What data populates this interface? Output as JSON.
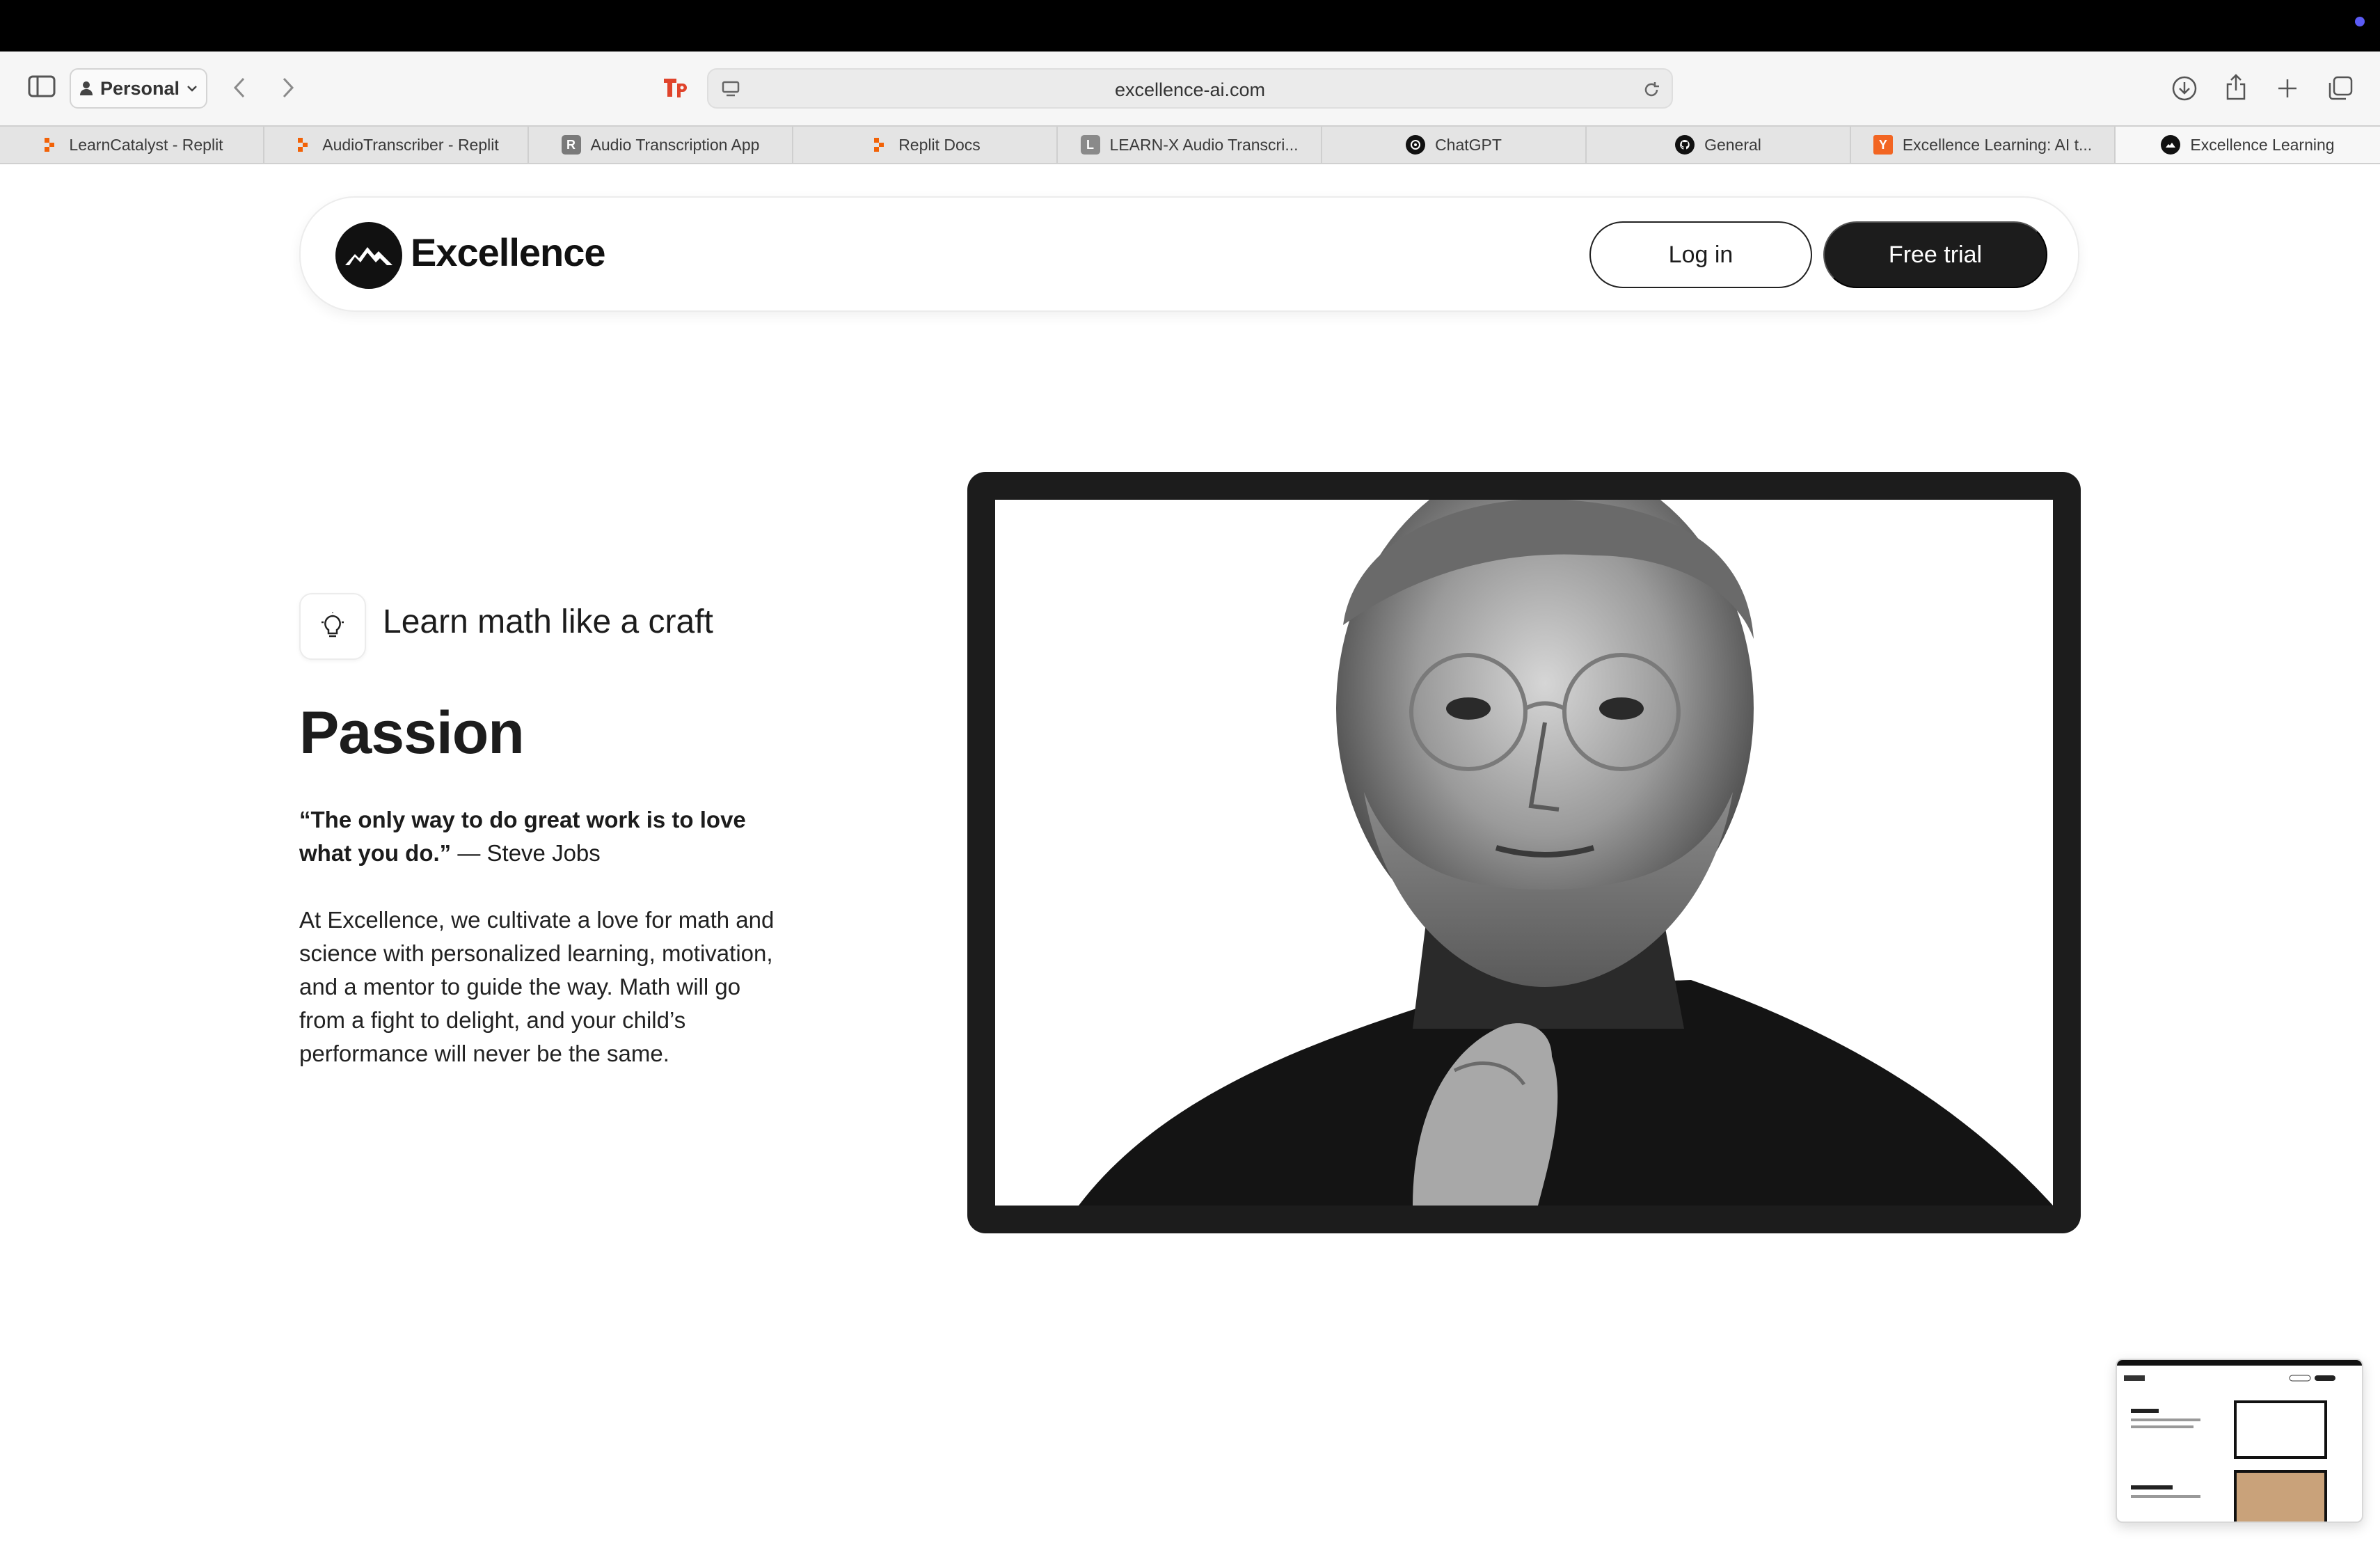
{
  "browser": {
    "profile_label": "Personal",
    "url": "excellence-ai.com",
    "tabs": [
      {
        "label": "LearnCatalyst - Replit",
        "icon": "replit-icon"
      },
      {
        "label": "AudioTranscriber - Replit",
        "icon": "replit-icon"
      },
      {
        "label": "Audio Transcription App",
        "icon": "r-letter-icon",
        "icon_letter": "R"
      },
      {
        "label": "Replit Docs",
        "icon": "replit-icon"
      },
      {
        "label": "LEARN-X Audio Transcri...",
        "icon": "l-letter-icon",
        "icon_letter": "L"
      },
      {
        "label": "ChatGPT",
        "icon": "chatgpt-icon"
      },
      {
        "label": "General",
        "icon": "github-icon"
      },
      {
        "label": "Excellence Learning: AI t...",
        "icon": "y-letter-icon",
        "icon_letter": "Y"
      },
      {
        "label": "Excellence Learning",
        "icon": "excellence-icon"
      }
    ]
  },
  "header": {
    "logo_text": "Excellence",
    "login_label": "Log in",
    "trial_label": "Free trial"
  },
  "hero": {
    "tag": "Learn math like a craft",
    "title": "Passion",
    "quote_bold": "“The only way to do great work is to love what you do.”",
    "quote_attribution": " — Steve Jobs",
    "body": "At Excellence, we cultivate a love for math and science with personalized learning, motivation, and a mentor to guide the way. Math will go from a fight to delight, and your child’s performance will never be the same."
  },
  "colors": {
    "accent_dark": "#1c1c1c",
    "replit_orange": "#f26207",
    "ext_red": "#e0442c"
  }
}
